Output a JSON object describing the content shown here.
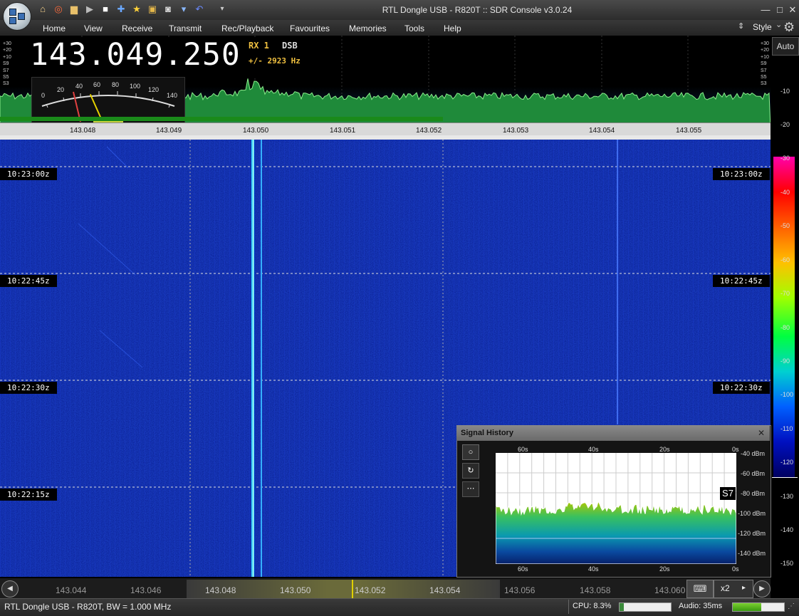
{
  "window": {
    "title": "RTL Dongle USB - R820T :: SDR Console v3.0.24",
    "style_label": "Style",
    "style_chevron": "⌄"
  },
  "menu": [
    "Home",
    "View",
    "Receive",
    "Transmit",
    "Rec/Playback",
    "Favourites",
    "Memories",
    "Tools",
    "Help"
  ],
  "quick_access": [
    "home-icon",
    "lifebuoy-icon",
    "folder-icon",
    "play-icon",
    "stop-icon",
    "add-icon",
    "star-icon",
    "lock-icon",
    "camera-icon",
    "drop-icon",
    "undo-icon",
    "dropdown-icon"
  ],
  "receiver": {
    "frequency": "143.049.250",
    "rx": "RX 1",
    "mode": "DSB",
    "offset": "+/- 2923 Hz",
    "signal_level": 0.3
  },
  "smeter_scale": [
    "0",
    "20",
    "40",
    "60",
    "80",
    "100",
    "120",
    "140"
  ],
  "spectrum": {
    "left_db_labels": [
      "+30",
      "+20",
      "+10",
      "S9",
      "S7",
      "S5",
      "S3"
    ],
    "right_db_labels": [
      "+30",
      "+20",
      "+10",
      "S9",
      "S7",
      "S5",
      "S3"
    ],
    "freq_ticks": [
      "143.048",
      "143.049",
      "143.050",
      "143.051",
      "143.052",
      "143.053",
      "143.054",
      "143.055"
    ]
  },
  "waterfall": {
    "time_labels": [
      "10:23:00z",
      "10:22:45z",
      "10:22:30z",
      "10:22:15z"
    ]
  },
  "colorbar": {
    "auto_label": "Auto",
    "labels": [
      "-10",
      "-20",
      "-30",
      "-40",
      "-50",
      "-60",
      "-70",
      "-80",
      "-90",
      "-100",
      "-110",
      "-120",
      "-130",
      "-140",
      "-150"
    ],
    "colors": [
      "#ff00aa",
      "#ff0000",
      "#ff6000",
      "#ffc000",
      "#a0ff00",
      "#00ff40",
      "#00d0d0",
      "#0060ff",
      "#0010c0",
      "#000060"
    ]
  },
  "signal_history": {
    "title": "Signal History",
    "close_label": "✕",
    "time_labels": [
      "60s",
      "40s",
      "20s",
      "0s"
    ],
    "db_labels": [
      "-40 dBm",
      "-60 dBm",
      "-80 dBm",
      "-100 dBm",
      "-120 dBm",
      "-140 dBm"
    ],
    "s_reading": "S7",
    "buttons": [
      "record-icon",
      "refresh-icon",
      "more-icon"
    ]
  },
  "bottom_scroll": {
    "freqs": [
      "143.044",
      "143.046",
      "143.048",
      "143.050",
      "143.052",
      "143.054",
      "143.056",
      "143.058",
      "143.060"
    ],
    "zoom": "x2"
  },
  "status": {
    "device": "RTL Dongle USB - R820T, BW = 1.000 MHz",
    "cpu": "CPU: 8.3%",
    "cpu_level": 0.08,
    "audio": "Audio: 35ms",
    "audio_level": 0.55
  }
}
